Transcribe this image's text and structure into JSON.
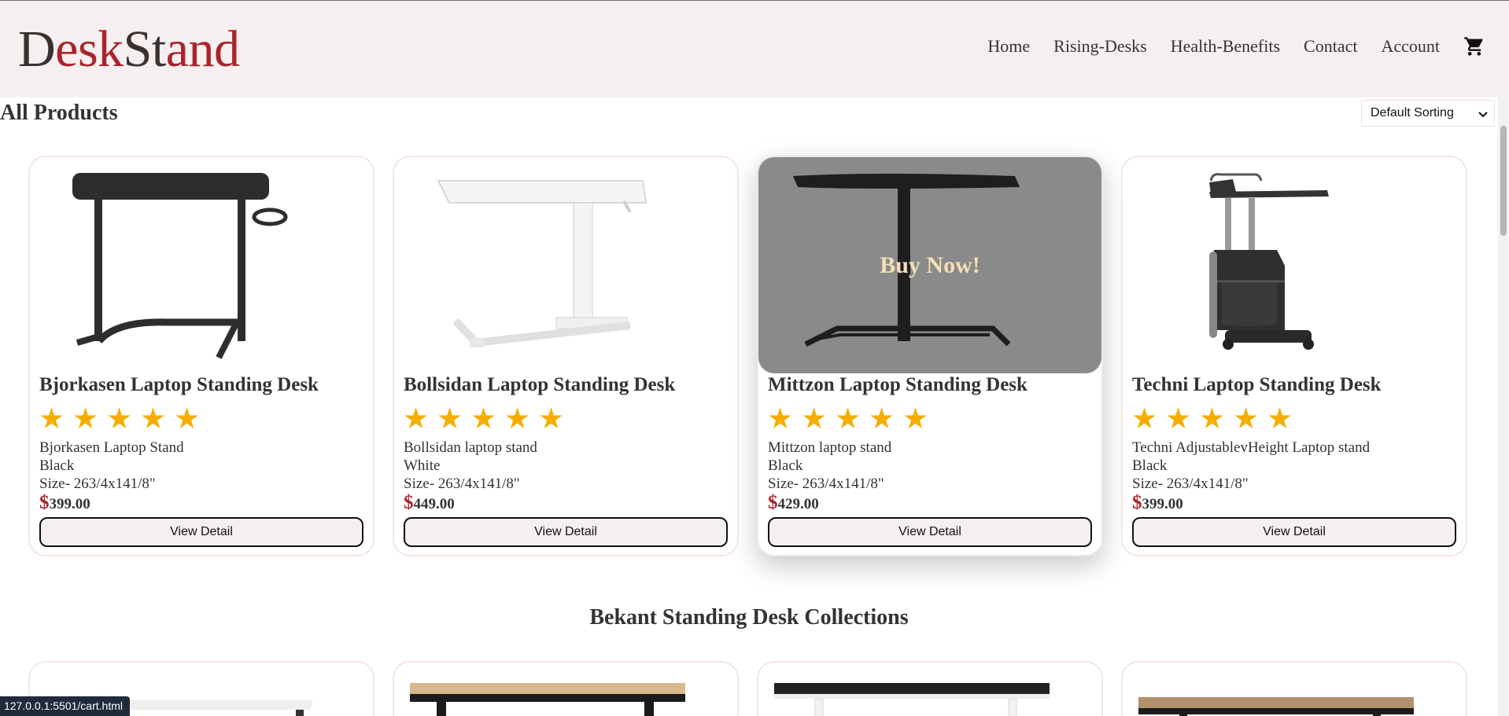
{
  "brand": {
    "part1": "D",
    "part2": "esk",
    "part3": "St",
    "part4": "and"
  },
  "nav": {
    "items": [
      {
        "label": "Home"
      },
      {
        "label": "Rising-Desks"
      },
      {
        "label": "Health-Benefits"
      },
      {
        "label": "Contact"
      },
      {
        "label": "Account"
      }
    ],
    "cart_icon": "shopping-cart-icon"
  },
  "page_title": "All Products",
  "sort": {
    "selected": "Default Sorting"
  },
  "products": [
    {
      "name": "Bjorkasen Laptop Standing Desk",
      "rating": 5,
      "line1": "Bjorkasen Laptop Stand",
      "line2": "Black",
      "line3": "Size- 263/4x141/8\"",
      "currency": "$",
      "price": "399.00",
      "button": "View Detail",
      "desk_color": "#2d2d2d"
    },
    {
      "name": "Bollsidan Laptop Standing Desk",
      "rating": 5,
      "line1": "Bollsidan laptop stand",
      "line2": "White",
      "line3": "Size- 263/4x141/8\"",
      "currency": "$",
      "price": "449.00",
      "button": "View Detail",
      "desk_color": "#f5f5f5"
    },
    {
      "name": "Mittzon Laptop Standing Desk",
      "rating": 5,
      "line1": "Mittzon laptop stand",
      "line2": "Black",
      "line3": "Size- 263/4x141/8\"",
      "currency": "$",
      "price": "429.00",
      "button": "View Detail",
      "overlay": "Buy Now!",
      "desk_color": "#1e1e1e"
    },
    {
      "name": "Techni Laptop Standing Desk",
      "rating": 5,
      "line1": "Techni AdjustablevHeight Laptop stand",
      "line2": "Black",
      "line3": "Size- 263/4x141/8\"",
      "currency": "$",
      "price": "399.00",
      "button": "View Detail",
      "desk_color": "#333333"
    }
  ],
  "section_title": "Bekant Standing Desk Collections",
  "status_url": "127.0.0.1:5501/cart.html",
  "colors": {
    "accent": "#a8242c",
    "header_bg": "#f6efef",
    "star": "#f5ae00",
    "overlay_text": "#f4dfb8"
  }
}
